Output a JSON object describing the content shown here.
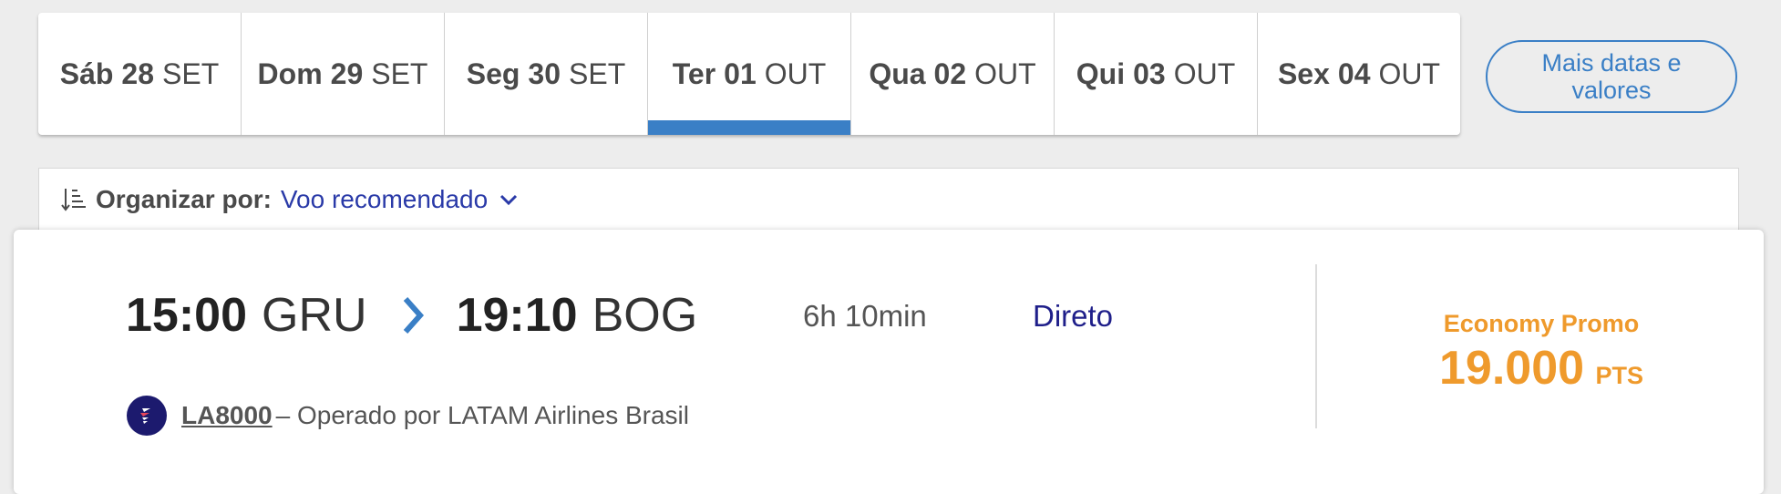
{
  "date_tabs": [
    {
      "weekday": "Sáb",
      "day": "28",
      "month": "SET",
      "active": false
    },
    {
      "weekday": "Dom",
      "day": "29",
      "month": "SET",
      "active": false
    },
    {
      "weekday": "Seg",
      "day": "30",
      "month": "SET",
      "active": false
    },
    {
      "weekday": "Ter",
      "day": "01",
      "month": "OUT",
      "active": true
    },
    {
      "weekday": "Qua",
      "day": "02",
      "month": "OUT",
      "active": false
    },
    {
      "weekday": "Qui",
      "day": "03",
      "month": "OUT",
      "active": false
    },
    {
      "weekday": "Sex",
      "day": "04",
      "month": "OUT",
      "active": false
    }
  ],
  "more_dates_button": "Mais datas e valores",
  "sort": {
    "label": "Organizar por:",
    "value": "Voo recomendado",
    "icon": "sort-icon"
  },
  "flight": {
    "departure_time": "15:00",
    "departure_airport": "GRU",
    "arrival_time": "19:10",
    "arrival_airport": "BOG",
    "duration": "6h 10min",
    "stops": "Direto",
    "flight_number": "LA8000",
    "operated_by": "– Operado por LATAM Airlines Brasil",
    "fare_class": "Economy Promo",
    "price": "19.000",
    "price_unit": "PTS"
  },
  "colors": {
    "accent_blue": "#3a7fc6",
    "sort_value": "#2a3aa8",
    "stops_text": "#1f1f8a",
    "fare_orange": "#ef9a2c",
    "airline_logo_bg": "#1c1a6e",
    "page_bg": "#ededed"
  }
}
